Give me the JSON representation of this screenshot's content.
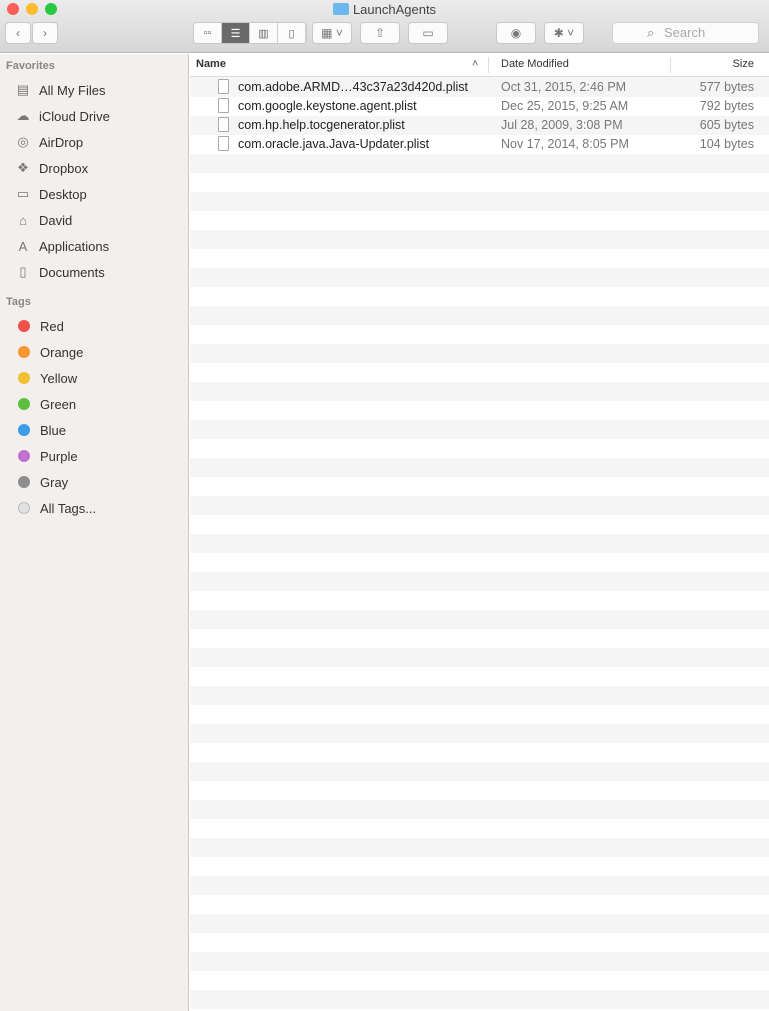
{
  "window": {
    "title": "LaunchAgents"
  },
  "toolbar": {
    "search_placeholder": "Search"
  },
  "sidebar": {
    "favorites_label": "Favorites",
    "favorites": [
      {
        "label": "All My Files",
        "icon": "all-files-icon",
        "glyph": "▤"
      },
      {
        "label": "iCloud Drive",
        "icon": "cloud-icon",
        "glyph": "☁"
      },
      {
        "label": "AirDrop",
        "icon": "airdrop-icon",
        "glyph": "◎"
      },
      {
        "label": "Dropbox",
        "icon": "dropbox-icon",
        "glyph": "❖"
      },
      {
        "label": "Desktop",
        "icon": "desktop-icon",
        "glyph": "▭"
      },
      {
        "label": "David",
        "icon": "home-icon",
        "glyph": "⌂"
      },
      {
        "label": "Applications",
        "icon": "applications-icon",
        "glyph": "A"
      },
      {
        "label": "Documents",
        "icon": "documents-icon",
        "glyph": "▯"
      }
    ],
    "tags_label": "Tags",
    "tags": [
      {
        "label": "Red",
        "color": "#f2504b"
      },
      {
        "label": "Orange",
        "color": "#f5962f"
      },
      {
        "label": "Yellow",
        "color": "#f0c02e"
      },
      {
        "label": "Green",
        "color": "#5cbe3c"
      },
      {
        "label": "Blue",
        "color": "#3d9be8"
      },
      {
        "label": "Purple",
        "color": "#c070d0"
      },
      {
        "label": "Gray",
        "color": "#8e8e8e"
      },
      {
        "label": "All Tags...",
        "color": "#e2e2e2"
      }
    ]
  },
  "columns": {
    "name": "Name",
    "date": "Date Modified",
    "size": "Size"
  },
  "files": [
    {
      "name": "com.adobe.ARMD…43c37a23d420d.plist",
      "date": "Oct 31, 2015, 2:46 PM",
      "size": "577 bytes"
    },
    {
      "name": "com.google.keystone.agent.plist",
      "date": "Dec 25, 2015, 9:25 AM",
      "size": "792 bytes"
    },
    {
      "name": "com.hp.help.tocgenerator.plist",
      "date": "Jul 28, 2009, 3:08 PM",
      "size": "605 bytes"
    },
    {
      "name": "com.oracle.java.Java-Updater.plist",
      "date": "Nov 17, 2014, 8:05 PM",
      "size": "104 bytes"
    }
  ]
}
